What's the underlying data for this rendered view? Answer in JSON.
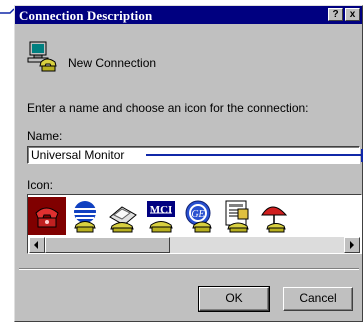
{
  "dialog": {
    "title": "Connection Description",
    "help_button": "?",
    "close_button": "x",
    "connection_name": "New Connection",
    "instruction": "Enter a name and choose an icon for the connection:",
    "name_label": "Name:",
    "name_value": "Universal Monitor",
    "icon_label": "Icon:",
    "icons": [
      "phone-red-icon",
      "globe-phone-icon",
      "fax-phone-icon",
      "mci-icon",
      "ge-icon",
      "document-phone-icon",
      "umbrella-phone-icon"
    ],
    "selected_icon_index": 0,
    "ok_label": "OK",
    "cancel_label": "Cancel"
  },
  "colors": {
    "title_bar": "#000080",
    "selection": "#800000",
    "face": "#c0c0c0",
    "annotation": "#1028a8"
  }
}
